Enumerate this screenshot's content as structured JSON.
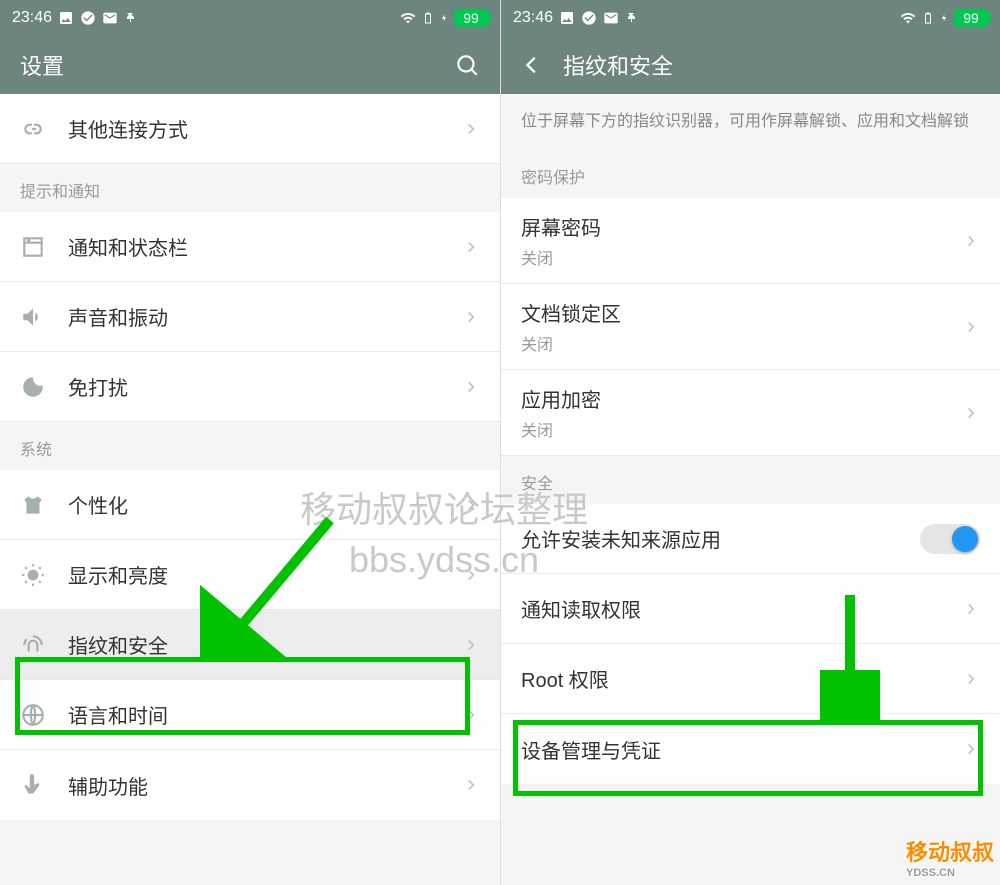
{
  "status": {
    "time": "23:46",
    "battery": "99"
  },
  "left": {
    "title": "设置",
    "rows": {
      "other_conn": "其他连接方式",
      "section_notify": "提示和通知",
      "notif_status": "通知和状态栏",
      "sound": "声音和振动",
      "dnd": "免打扰",
      "section_system": "系统",
      "personalize": "个性化",
      "display": "显示和亮度",
      "fingerprint": "指纹和安全",
      "language": "语言和时间",
      "accessibility": "辅助功能"
    }
  },
  "right": {
    "title": "指纹和安全",
    "desc": "位于屏幕下方的指纹识别器，可用作屏幕解锁、应用和文档解锁",
    "section_pw": "密码保护",
    "screen_pw": "屏幕密码",
    "doc_lock": "文档锁定区",
    "app_enc": "应用加密",
    "off": "关闭",
    "section_security": "安全",
    "unknown_sources": "允许安装未知来源应用",
    "notif_access": "通知读取权限",
    "root": "Root 权限",
    "device_admin": "设备管理与凭证"
  },
  "watermark": {
    "line1": "移动叔叔论坛整理",
    "line2": "bbs.ydss.cn"
  },
  "logo": {
    "text": "移动叔叔",
    "sub": "YDSS.CN"
  }
}
